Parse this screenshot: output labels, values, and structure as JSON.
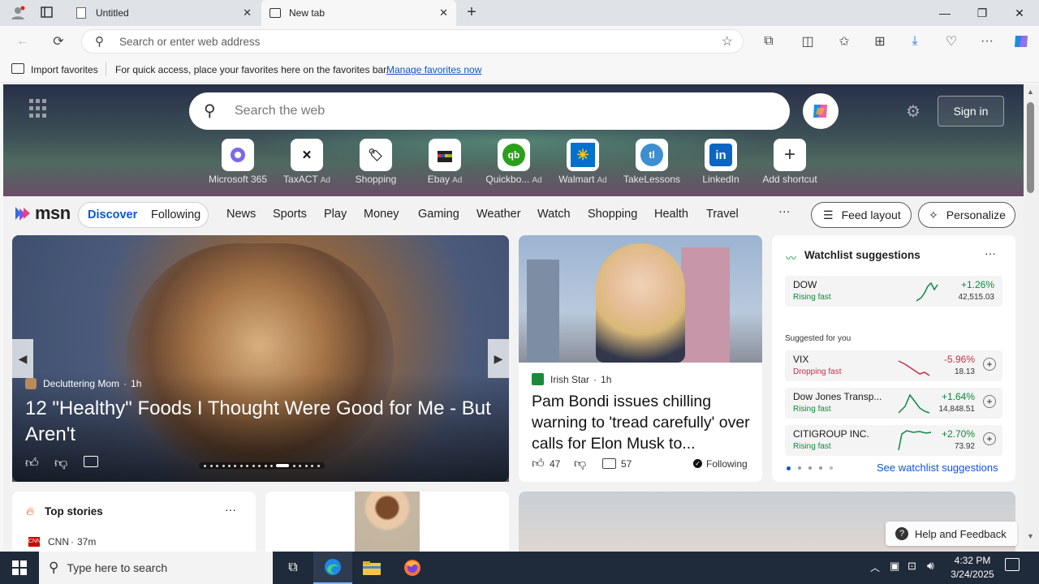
{
  "browser": {
    "tabs": [
      {
        "title": "Untitled",
        "icon": "page-icon"
      },
      {
        "title": "New tab",
        "icon": "newtab-icon"
      }
    ],
    "address_placeholder": "Search or enter web address",
    "favorites_bar": {
      "import_label": "Import favorites",
      "message": "For quick access, place your favorites here on the favorites bar.",
      "manage_link": "Manage favorites now"
    }
  },
  "newtab": {
    "search_placeholder": "Search the web",
    "sign_in": "Sign in",
    "shortcuts": [
      {
        "label": "Microsoft 365",
        "ad": false,
        "icon": "m365-icon"
      },
      {
        "label": "TaxACT",
        "ad": true,
        "icon": "taxact-icon"
      },
      {
        "label": "Shopping",
        "ad": false,
        "icon": "tag-icon"
      },
      {
        "label": "Ebay",
        "ad": true,
        "icon": "ebay-icon"
      },
      {
        "label": "Quickbo...",
        "ad": true,
        "icon": "quickbooks-icon"
      },
      {
        "label": "Walmart",
        "ad": true,
        "icon": "walmart-icon"
      },
      {
        "label": "TakeLessons",
        "ad": false,
        "icon": "takelessons-icon"
      },
      {
        "label": "LinkedIn",
        "ad": false,
        "icon": "linkedin-icon"
      },
      {
        "label": "Add shortcut",
        "ad": false,
        "icon": "plus-icon"
      }
    ],
    "ad_label": "Ad"
  },
  "msn": {
    "logo": "msn",
    "tabs": [
      "Discover",
      "Following"
    ],
    "nav": [
      "News",
      "Sports",
      "Play",
      "Money",
      "Gaming",
      "Weather",
      "Watch",
      "Shopping",
      "Health",
      "Travel"
    ],
    "more": "···",
    "feed_layout": "Feed layout",
    "personalize": "Personalize"
  },
  "hero_story": {
    "source": "Decluttering Mom",
    "age": "1h",
    "title": "12 \"Healthy\" Foods I Thought Were Good for Me - But Aren't"
  },
  "side_story": {
    "source": "Irish Star",
    "age": "1h",
    "title": "Pam Bondi issues chilling warning to 'tread carefully' over calls for Elon Musk to...",
    "likes": "47",
    "comments": "57",
    "following": "Following"
  },
  "watchlist": {
    "title": "Watchlist suggestions",
    "suggested_label": "Suggested for you",
    "see_more": "See watchlist suggestions",
    "items": [
      {
        "name": "DOW",
        "status": "Rising fast",
        "change": "+1.26%",
        "value": "42,515.03",
        "dir": "up"
      },
      {
        "name": "VIX",
        "status": "Dropping fast",
        "change": "-5.96%",
        "value": "18.13",
        "dir": "down"
      },
      {
        "name": "Dow Jones Transp...",
        "status": "Rising fast",
        "change": "+1.64%",
        "value": "14,848.51",
        "dir": "up"
      },
      {
        "name": "CITIGROUP INC.",
        "status": "Rising fast",
        "change": "+2.70%",
        "value": "73.92",
        "dir": "up"
      }
    ]
  },
  "top_stories": {
    "title": "Top stories",
    "first_source": "CNN",
    "first_age": "37m"
  },
  "help_feedback": "Help and Feedback",
  "taskbar": {
    "search_placeholder": "Type here to search",
    "time": "4:32 PM",
    "date": "3/24/2025"
  }
}
